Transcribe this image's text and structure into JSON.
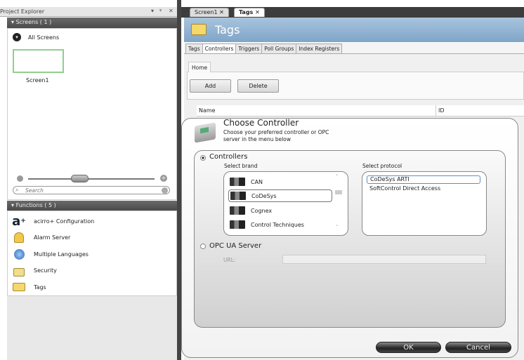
{
  "explorer": {
    "title": "Project Explorer",
    "controls": [
      "▾",
      "ᵠ",
      "✕"
    ],
    "screens_header": "Screens ( 1 )",
    "all_screens": "All Screens",
    "screen_name": "Screen1",
    "search_placeholder": "Search",
    "functions_header": "Functions ( 5 )",
    "functions": [
      {
        "label": "acirro+ Configuration",
        "icon": "acirro-icon"
      },
      {
        "label": "Alarm Server",
        "icon": "bell-icon"
      },
      {
        "label": "Multiple Languages",
        "icon": "globe-icon"
      },
      {
        "label": "Security",
        "icon": "lock-icon"
      },
      {
        "label": "Tags",
        "icon": "folders-icon"
      }
    ]
  },
  "doc_tabs": [
    {
      "label": "Screen1 ✕"
    },
    {
      "label": "Tags ✕"
    }
  ],
  "tags": {
    "title": "Tags",
    "subtabs": [
      "Tags",
      "Controllers",
      "Triggers",
      "Poll Groups",
      "Index Registers"
    ],
    "ribbon_tab": "Home",
    "add": "Add",
    "delete": "Delete",
    "columns": [
      "Name",
      "ID"
    ]
  },
  "dialog": {
    "title": "Choose Controller",
    "subtitle_1": "Choose your preferred controller or OPC",
    "subtitle_2": "server in the menu below",
    "controllers_label": "Controllers",
    "brand_label": "Select brand",
    "protocol_label": "Select protocol",
    "brands": [
      "CAN",
      "CoDeSys",
      "Cognex",
      "Control Techniques"
    ],
    "selected_brand": "CoDeSys",
    "protocols": [
      "CoDeSys ARTI",
      "SoftControl Direct Access"
    ],
    "opc_label": "OPC UA Server",
    "url_label": "URL:",
    "url_value": "",
    "ok": "OK",
    "cancel": "Cancel"
  }
}
